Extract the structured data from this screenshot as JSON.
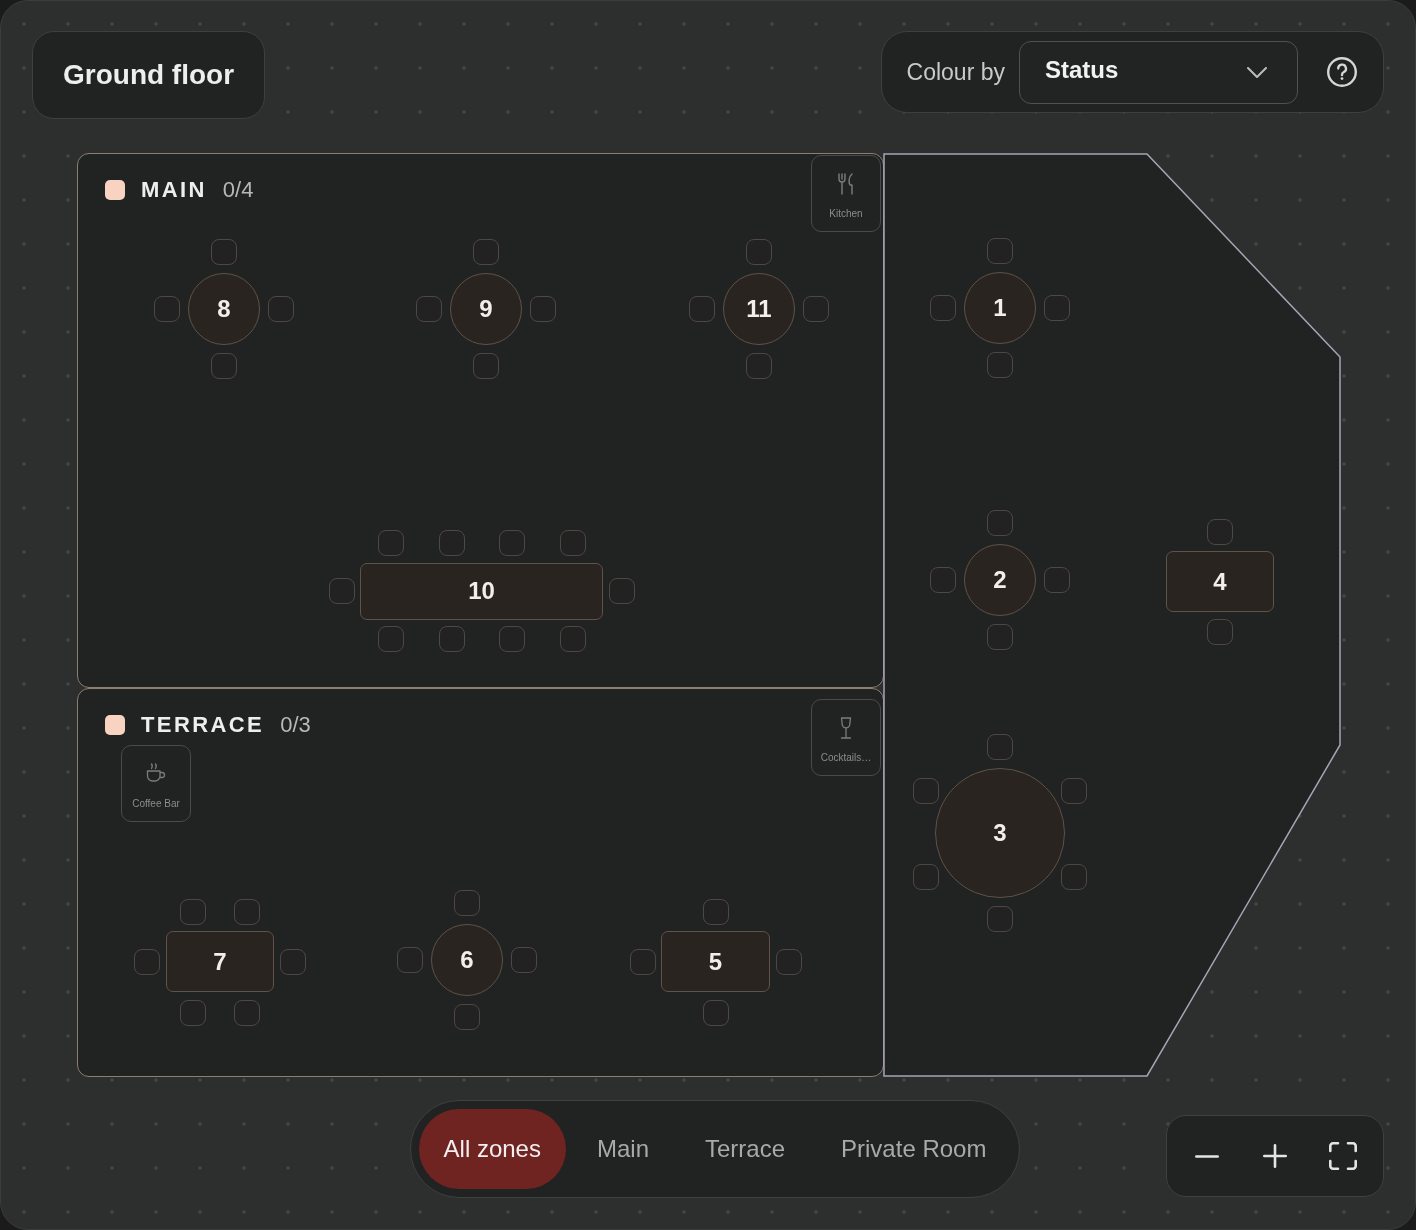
{
  "floor": {
    "title": "Ground floor"
  },
  "colour_by": {
    "label": "Colour by",
    "value": "Status"
  },
  "zones": [
    {
      "kind": "rect",
      "name": "MAIN",
      "count": "0/4",
      "color": "#f9d3c1",
      "stations": [
        {
          "kind": "kitchen",
          "label": "Kitchen"
        }
      ],
      "tables": [
        {
          "label": "8",
          "kind": "round"
        },
        {
          "label": "9",
          "kind": "round"
        },
        {
          "label": "11",
          "kind": "round"
        },
        {
          "label": "10",
          "kind": "rect"
        }
      ]
    },
    {
      "kind": "rect",
      "name": "TERRACE",
      "count": "0/3",
      "color": "#f9d3c1",
      "stations": [
        {
          "kind": "coffee",
          "label": "Coffee Bar"
        },
        {
          "kind": "cocktails",
          "label": "Cocktails…"
        }
      ],
      "tables": [
        {
          "label": "7",
          "kind": "rect"
        },
        {
          "label": "6",
          "kind": "round"
        },
        {
          "label": "5",
          "kind": "rect"
        }
      ]
    },
    {
      "kind": "angled",
      "tables": [
        {
          "label": "1",
          "kind": "round"
        },
        {
          "label": "2",
          "kind": "round"
        },
        {
          "label": "4",
          "kind": "rect"
        },
        {
          "label": "3",
          "kind": "round"
        }
      ]
    }
  ],
  "zone_tabs": [
    {
      "label": "All zones",
      "selected": true
    },
    {
      "label": "Main",
      "selected": false
    },
    {
      "label": "Terrace",
      "selected": false
    },
    {
      "label": "Private Room",
      "selected": false
    }
  ]
}
